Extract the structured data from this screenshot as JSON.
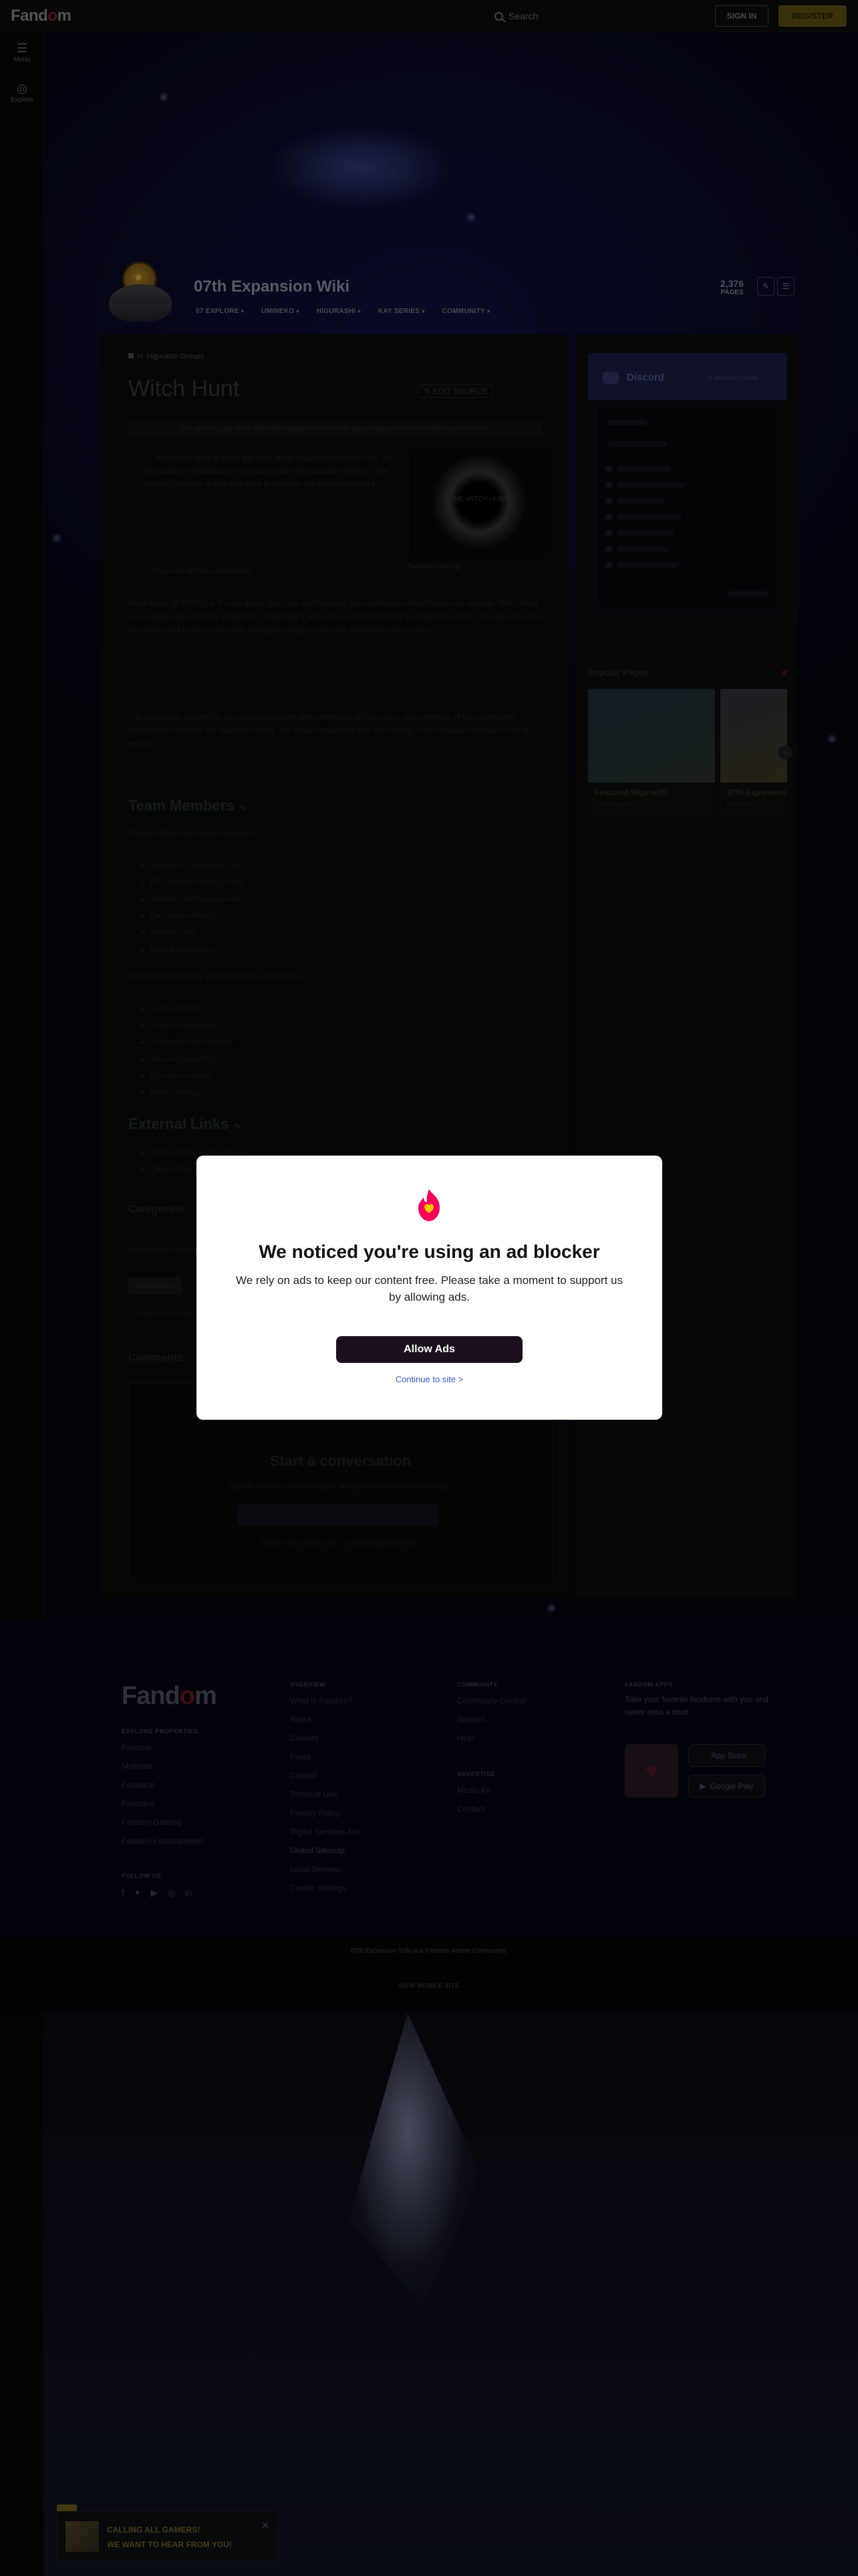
{
  "topbar": {
    "brand_pre": "Fand",
    "brand_o": "o",
    "brand_post": "m",
    "search_placeholder": "Search",
    "sign_in": "SIGN IN",
    "register": "REGISTER"
  },
  "leftrail": {
    "items": [
      {
        "label": "Menu",
        "icon": "hamburger-icon"
      },
      {
        "label": "Explore",
        "icon": "compass-icon"
      }
    ]
  },
  "wiki": {
    "title": "07th Expansion Wiki",
    "nav": [
      "07 EXPLORE",
      "UMINEKO",
      "HIGURASHI",
      "KAY SERIES",
      "COMMUNITY"
    ],
    "pages_count": "2,376",
    "pages_label": "PAGES"
  },
  "article": {
    "breadcrumb": "in: Higurashi Groups",
    "title": "Witch Hunt",
    "comments_link": "",
    "edit_label": "EDIT SOURCE",
    "notice": "This article is part of the Witch Hunt group. For the article about Higurashi, see the Witch Hunt Chronicle.",
    "quote": "\"... those who want to learn the truth about Oyashiro-sama's curse, an organization dedicated to the study of the Hinamizawa mystery. They believe Oyashiro is real and seek to uncover the secrets behind it.\"",
    "quote_cite": "— Higurashi no Naku Koro ni Kai",
    "image_caption": "The Witch Hunt logo",
    "image_overlay": "THE WITCH HUNT",
    "para1": "Witch Hunt (魔女狩り) is the fan group that runs the Higurashi Sound Novel's official forum and website. Witch Hunt was a doujin group led by Ryukishi07. Originally it was a forum for discussing the Higurashi series. The group's name was later used for the community of players trying to solve the mysteries of the series.",
    "para2": "The group was notable for its collaboration with other members of the series, and members of the community contributed works for the Higurashi world. The group disbanded after the closing of the Umineko no Naku Koro ni website.",
    "team_heading": "Team Members",
    "team_intro": "Original Witch Hunt team members:",
    "team_list": [
      "Ryukishi07 (scenario, art)",
      "BT (scenario editing, web)",
      "Yashiro (chief programmer)",
      "Dai (sound effects)",
      "Shimizu (art)",
      "Banzai (manager)"
    ],
    "later_intro": "Witch Hunt members who joined the circle later on:",
    "later_list": [
      "Luna (support)",
      "Keikei (translation)",
      "Tachibana (art support)",
      "Takuma (graphics)",
      "Kiyotaka (editing)",
      "Nobu (writing)"
    ],
    "links_heading": "External Links",
    "links_list": [
      "Official Witch Hunt website",
      "Official 07th Expansion website"
    ],
    "categories_heading": "Categories",
    "categories_sub": "Community content is available under CC-BY-SA unless otherwise noted.",
    "categories_pill": "Witch Hunt",
    "categories_text": "Higurashi Groups",
    "comments_heading": "Comments",
    "conv_title": "Start a conversation",
    "conv_sub": "Sign in to share your thoughts and join the conversation going.",
    "conv_note": "Read more about our Community guidelines."
  },
  "sidebar": {
    "discord_title": "Discord",
    "discord_online": "12 Members Online",
    "popular_heading": "Popular Pages",
    "cards": [
      {
        "label": "Featured Higurashi",
        "sub": "07th Expansion"
      },
      {
        "label": "07th Expansion",
        "sub": "Umineko"
      }
    ]
  },
  "footer": {
    "brand_pre": "Fand",
    "brand_o": "o",
    "brand_post": "m",
    "col1_head": "EXPLORE PROPERTIES",
    "col1": [
      "Fandom",
      "Muthead",
      "Fanatical",
      "Fansided",
      "Fandom Gaming",
      "Fandom Entertainment"
    ],
    "follow_head": "FOLLOW US",
    "col2_head": "OVERVIEW",
    "col2": [
      "What is Fandom?",
      "About",
      "Careers",
      "Press",
      "Contact",
      "Terms of Use",
      "Privacy Policy",
      "Digital Services Act",
      "Global Sitemap",
      "Local Sitemap",
      "Cookie Settings"
    ],
    "col3_head": "COMMUNITY",
    "col3": [
      "Community Central",
      "Support",
      "Help"
    ],
    "col3b_head": "ADVERTISE",
    "col3b": [
      "Media Kit",
      "Contact"
    ],
    "col4_head": "FANDOM APPS",
    "app_desc": "Take your favorite fandoms with you and never miss a beat.",
    "app_store": "App Store",
    "google_play": "Google Play",
    "bottom_line": "07th Expansion Wiki is a Fandom Anime Community.",
    "bottom_mobile": "VIEW MOBILE SITE"
  },
  "modal": {
    "title": "We noticed you're using an ad blocker",
    "desc": "We rely on ads to keep our content free. Please take a moment to support us by allowing ads.",
    "allow": "Allow Ads",
    "continue": "Continue to site >"
  },
  "promo": {
    "line1": "CALLING ALL GAMERS!",
    "line2": "WE WANT TO HEAR FROM YOU!"
  },
  "colors": {
    "accent_fandom": "#fa005a",
    "allow_button": "#1c0f1d",
    "link_blue": "#3a57c9"
  }
}
